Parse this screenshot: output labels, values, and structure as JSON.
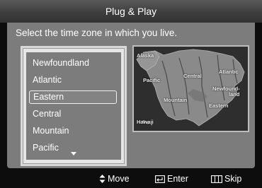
{
  "title": "Plug & Play",
  "instruction": "Select the time zone in which you live.",
  "timezones": [
    "Newfoundland",
    "Atlantic",
    "Eastern",
    "Central",
    "Mountain",
    "Pacific"
  ],
  "selected_timezone": "Eastern",
  "map_labels": {
    "alaska": "Alaska",
    "pacific": "Pacific",
    "central": "Central",
    "atlantic": "Atlantic",
    "newfoundland_1": "Newfound-",
    "newfoundland_2": "land",
    "mountain": "Mountain",
    "eastern": "Eastern",
    "hawaii": "Hawaii"
  },
  "footer": {
    "move": "Move",
    "enter": "Enter",
    "skip": "Skip"
  },
  "icons": {
    "move": "up-down-arrow-icon",
    "enter": "enter-icon",
    "skip": "skip-icon",
    "scroll": "scroll-down-arrow-icon"
  }
}
